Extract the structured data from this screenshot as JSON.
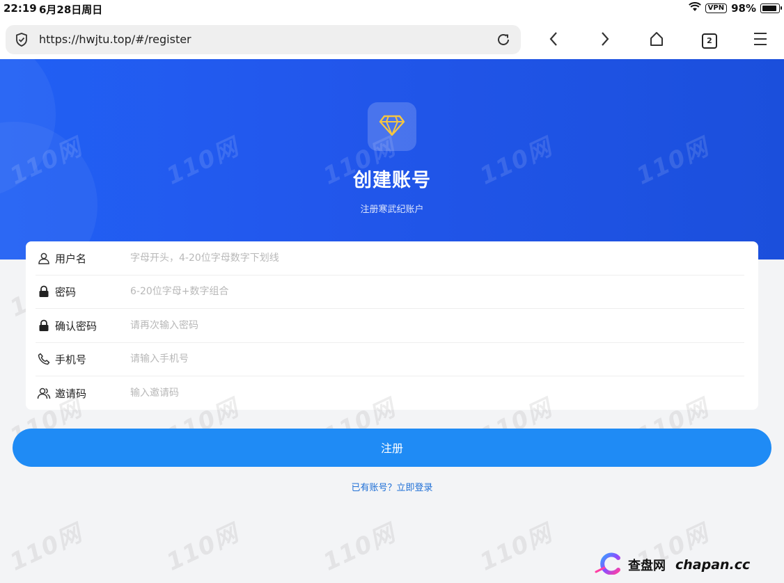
{
  "status_bar": {
    "time": "22:19",
    "date": "6月28日周日",
    "vpn": "VPN",
    "battery": "98%"
  },
  "browser": {
    "url": "https://hwjtu.top/#/register",
    "tab_count": "2",
    "icons": [
      "shield-check-icon",
      "reload-icon",
      "back-icon",
      "forward-icon",
      "home-icon",
      "tabs-icon",
      "menu-icon"
    ]
  },
  "hero": {
    "logo_icon": "diamond-icon",
    "title": "创建账号",
    "subtitle": "注册寒武纪账户"
  },
  "form": {
    "fields": [
      {
        "label": "用户名",
        "placeholder": "字母开头，4-20位字母数字下划线",
        "value": "",
        "icon": "user-icon"
      },
      {
        "label": "密码",
        "placeholder": "6-20位字母+数字组合",
        "value": "",
        "icon": "lock-icon"
      },
      {
        "label": "确认密码",
        "placeholder": "请再次输入密码",
        "value": "",
        "icon": "lock-icon"
      },
      {
        "label": "手机号",
        "placeholder": "请输入手机号",
        "value": "",
        "icon": "phone-icon"
      },
      {
        "label": "邀请码",
        "placeholder": "输入邀请码",
        "value": "",
        "icon": "users-icon"
      }
    ],
    "submit_label": "注册",
    "login_link": "已有账号？立即登录"
  },
  "watermark": "110网",
  "brand": {
    "name": "查盘网",
    "url": "chapan.cc"
  },
  "colors": {
    "hero_blue": "#2160f4",
    "button_blue": "#1f8bf5",
    "link_blue": "#1f6fd6",
    "diamond_gold": "#f5c542",
    "page_bg": "#f3f4f6"
  }
}
